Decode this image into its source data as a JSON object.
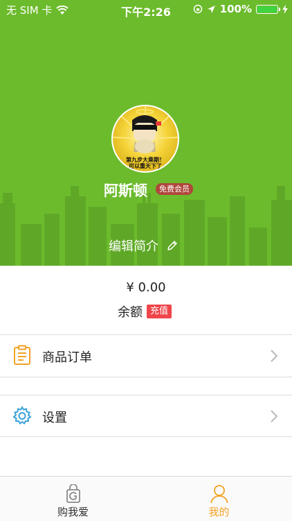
{
  "status_bar": {
    "carrier": "无 SIM 卡",
    "time": "下午2:26",
    "battery": "100%"
  },
  "profile": {
    "username": "阿斯顿",
    "member_badge": "免费会员",
    "edit_bio": "编辑简介",
    "avatar_text_line1": "第九步大乘期！",
    "avatar_text_line2": "可以重天下了"
  },
  "balance": {
    "amount": "¥ 0.00",
    "label": "余额",
    "recharge": "充值"
  },
  "menu": [
    {
      "label": "商品订单",
      "icon": "clipboard-icon"
    },
    {
      "label": "设置",
      "icon": "gear-icon"
    }
  ],
  "tabbar": {
    "tabs": [
      {
        "label": "购我爱",
        "icon": "shopping-bag-icon",
        "active": false
      },
      {
        "label": "我的",
        "icon": "person-icon",
        "active": true
      }
    ]
  },
  "colors": {
    "header_green": "#6cbb2c",
    "accent_orange": "#f3a224",
    "badge_red": "#b0473d",
    "recharge_red": "#f0454b"
  }
}
